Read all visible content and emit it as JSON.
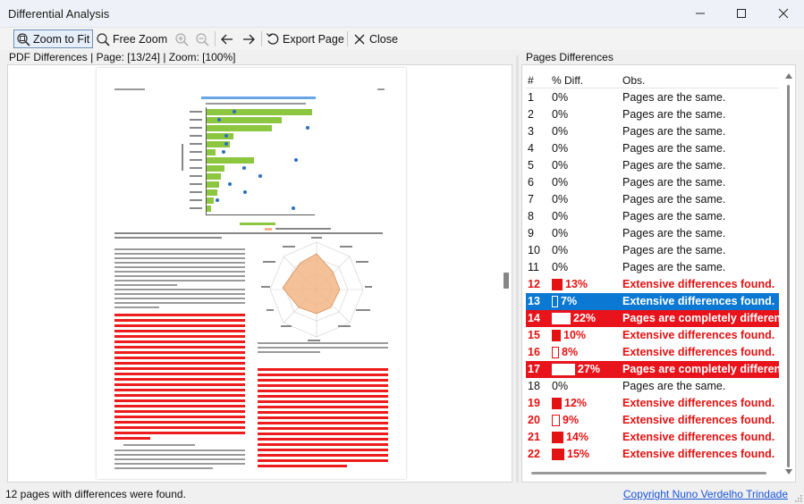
{
  "window": {
    "title": "Differential Analysis"
  },
  "toolbar": {
    "zoom_fit": "Zoom to Fit",
    "free_zoom": "Free Zoom",
    "export_page": "Export Page",
    "close": "Close"
  },
  "left_panel": {
    "caption": "PDF Differences | Page: [13/24] | Zoom: [100%]"
  },
  "right_panel": {
    "caption": "Pages Differences",
    "columns": [
      "#",
      "% Diff.",
      "Obs."
    ],
    "rows": [
      {
        "num": "1",
        "pct": "0%",
        "obs": "Pages are the same.",
        "state": "same",
        "level": 0
      },
      {
        "num": "2",
        "pct": "0%",
        "obs": "Pages are the same.",
        "state": "same",
        "level": 0
      },
      {
        "num": "3",
        "pct": "0%",
        "obs": "Pages are the same.",
        "state": "same",
        "level": 0
      },
      {
        "num": "4",
        "pct": "0%",
        "obs": "Pages are the same.",
        "state": "same",
        "level": 0
      },
      {
        "num": "5",
        "pct": "0%",
        "obs": "Pages are the same.",
        "state": "same",
        "level": 0
      },
      {
        "num": "6",
        "pct": "0%",
        "obs": "Pages are the same.",
        "state": "same",
        "level": 0
      },
      {
        "num": "7",
        "pct": "0%",
        "obs": "Pages are the same.",
        "state": "same",
        "level": 0
      },
      {
        "num": "8",
        "pct": "0%",
        "obs": "Pages are the same.",
        "state": "same",
        "level": 0
      },
      {
        "num": "9",
        "pct": "0%",
        "obs": "Pages are the same.",
        "state": "same",
        "level": 0
      },
      {
        "num": "10",
        "pct": "0%",
        "obs": "Pages are the same.",
        "state": "same",
        "level": 0
      },
      {
        "num": "11",
        "pct": "0%",
        "obs": "Pages are the same.",
        "state": "same",
        "level": 0
      },
      {
        "num": "12",
        "pct": "13%",
        "obs": "Extensive differences found.",
        "state": "diff",
        "level": 13
      },
      {
        "num": "13",
        "pct": "7%",
        "obs": "Extensive differences found.",
        "state": "selected",
        "level": 7
      },
      {
        "num": "14",
        "pct": "22%",
        "obs": "Pages are completely different.",
        "state": "complete",
        "level": 22
      },
      {
        "num": "15",
        "pct": "10%",
        "obs": "Extensive differences found.",
        "state": "diff",
        "level": 10
      },
      {
        "num": "16",
        "pct": "8%",
        "obs": "Extensive differences found.",
        "state": "diff-box",
        "level": 8
      },
      {
        "num": "17",
        "pct": "27%",
        "obs": "Pages are completely different.",
        "state": "complete",
        "level": 27
      },
      {
        "num": "18",
        "pct": "0%",
        "obs": "Pages are the same.",
        "state": "same",
        "level": 0
      },
      {
        "num": "19",
        "pct": "12%",
        "obs": "Extensive differences found.",
        "state": "diff",
        "level": 12
      },
      {
        "num": "20",
        "pct": "9%",
        "obs": "Extensive differences found.",
        "state": "diff-box",
        "level": 9
      },
      {
        "num": "21",
        "pct": "14%",
        "obs": "Extensive differences found.",
        "state": "diff",
        "level": 14
      },
      {
        "num": "22",
        "pct": "15%",
        "obs": "Extensive differences found.",
        "state": "diff",
        "level": 15
      }
    ]
  },
  "status": {
    "message": "12 pages with differences were found.",
    "copyright": "Copyright Nuno Verdelho Trindade"
  },
  "colors": {
    "accent": "#0b79d3",
    "diff_red": "#e31313",
    "link": "#1a55d8"
  }
}
